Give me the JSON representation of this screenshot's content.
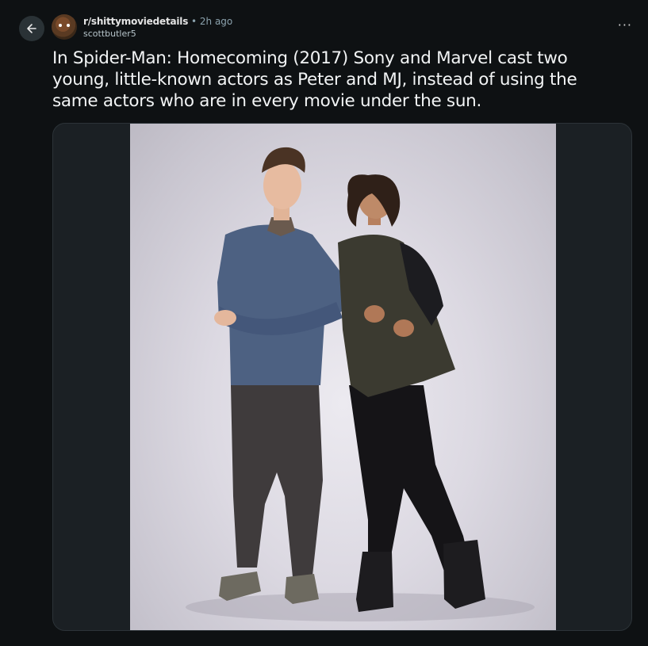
{
  "header": {
    "subreddit": "r/shittymoviedetails",
    "separator": "•",
    "time": "2h ago",
    "author": "scottbutler5",
    "more_label": "···"
  },
  "post": {
    "title": "In Spider-Man: Homecoming (2017) Sony and Marvel cast two young, little-known actors as Peter and MJ, instead of using the same actors who are in every movie under the sun."
  },
  "icons": {
    "back": "arrow-left-icon",
    "more": "more-horizontal-icon"
  },
  "colors": {
    "page_bg": "#0e1113",
    "media_bg": "#1b2024",
    "photo_backdrop": "#dcd9e2",
    "sweater": "#4d6182",
    "jacket": "#3b3a30"
  }
}
